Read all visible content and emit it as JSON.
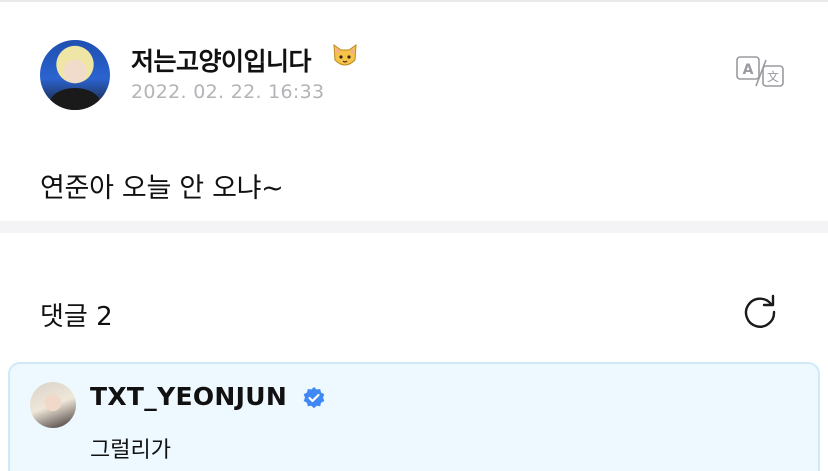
{
  "post": {
    "author": "저는고양이입니다",
    "author_emoji": "cat-face-icon",
    "date": "2022. 02. 22. 16:33",
    "body": "연준아 오늘 안 오냐~"
  },
  "comments": {
    "title": "댓글 2",
    "items": [
      {
        "author": "TXT_YEONJUN",
        "verified": true,
        "text": "그럴리가"
      }
    ]
  },
  "colors": {
    "date_gray": "#b3b3b8",
    "divider": "#f4f4f7",
    "comment_bg": "#eef9ff",
    "comment_border": "#cfe9f7",
    "verified_blue": "#3f88f5"
  }
}
